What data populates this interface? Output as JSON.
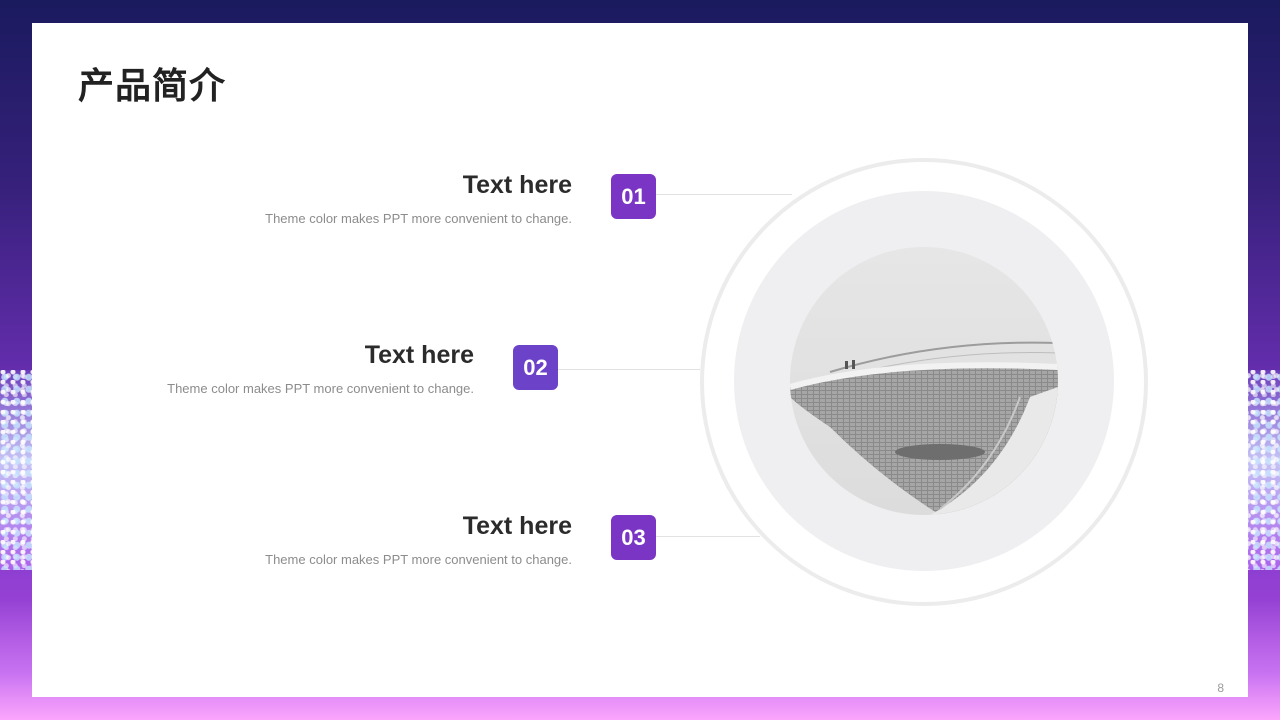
{
  "slide": {
    "title": "产品简介",
    "page_number": "8"
  },
  "items": [
    {
      "number": "01",
      "heading": "Text here",
      "description": "Theme color makes PPT more convenient to change.",
      "color": "#7b35c4"
    },
    {
      "number": "02",
      "heading": "Text here",
      "description": "Theme color makes PPT more convenient to change.",
      "color": "#6c42c9"
    },
    {
      "number": "03",
      "heading": "Text here",
      "description": "Theme color makes PPT more convenient to change.",
      "color": "#7b35c4"
    }
  ],
  "image": {
    "icon": "architecture-photo"
  },
  "colors": {
    "accent": "#7b35c4",
    "background_top": "#1a1a5e",
    "background_bottom": "#b24fe0"
  }
}
